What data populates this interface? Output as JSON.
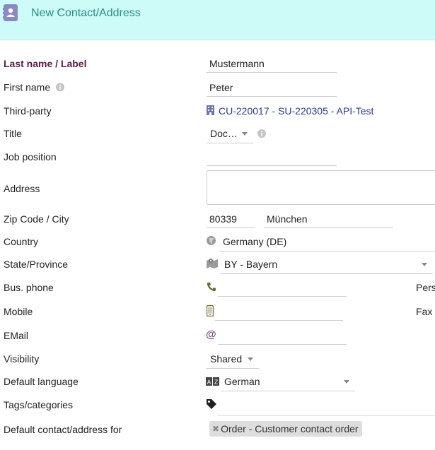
{
  "header": {
    "title": "New Contact/Address",
    "icon": "contact-card-icon",
    "accent": "#2a8f88",
    "background": "#cdfbf7"
  },
  "form": {
    "last_name": {
      "label": "Last name / Label",
      "value": "Mustermann"
    },
    "first_name": {
      "label": "First name",
      "value": "Peter"
    },
    "third_party": {
      "label": "Third-party",
      "value": "CU-220017 - SU-220305 - API-Test"
    },
    "title": {
      "label": "Title",
      "value": "Doc…"
    },
    "job_position": {
      "label": "Job position",
      "value": ""
    },
    "address": {
      "label": "Address",
      "value": ""
    },
    "zip_city": {
      "label": "Zip Code / City",
      "zip": "80339",
      "city": "München"
    },
    "country": {
      "label": "Country",
      "value": "Germany (DE)"
    },
    "state": {
      "label": "State/Province",
      "value": "BY - Bayern"
    },
    "bus_phone": {
      "label": "Bus. phone",
      "value": "",
      "side_label": "Pers"
    },
    "mobile": {
      "label": "Mobile",
      "value": "",
      "side_label": "Fax"
    },
    "email": {
      "label": "EMail",
      "value": ""
    },
    "visibility": {
      "label": "Visibility",
      "value": "Shared"
    },
    "default_language": {
      "label": "Default language",
      "value": "German"
    },
    "tags": {
      "label": "Tags/categories"
    },
    "default_for": {
      "label": "Default contact/address for",
      "tag": "Order - Customer contact order"
    }
  },
  "colors": {
    "required_label": "#5a1e49",
    "link": "#263c8b",
    "icon_gray": "#999999",
    "phone_icon": "#6a6a2a",
    "at_icon": "#7b4b8b"
  }
}
